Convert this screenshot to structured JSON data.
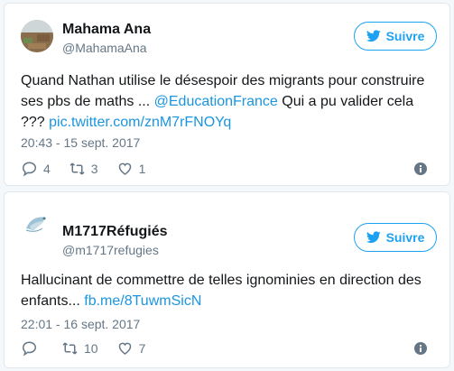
{
  "tweets": [
    {
      "name": "Mahama Ana",
      "handle": "@MahamaAna",
      "follow_label": "Suivre",
      "text_plain": "Quand Nathan utilise le désespoir des migrants pour construire ses pbs de maths ... ",
      "mention": "@EducationFrance",
      "text_after_mention": " Qui a pu valider cela ??? ",
      "link": "pic.twitter.com/znM7rFNOYq",
      "time": "20:43 - 15 sept. 2017",
      "replies": "4",
      "retweets": "3",
      "likes": "1"
    },
    {
      "name": "M1717Réfugiés",
      "handle": "@m1717refugies",
      "follow_label": "Suivre",
      "text_plain": "Hallucinant de commettre de telles ignominies en direction des enfants... ",
      "link": "fb.me/8TuwmSicN",
      "time": "22:01 - 16 sept. 2017",
      "replies": "",
      "retweets": "10",
      "likes": "7"
    }
  ],
  "colors": {
    "accent": "#1da1f2",
    "link": "#1b95e0",
    "muted": "#657786",
    "border": "#e1e8ed"
  },
  "icons": [
    "twitter-bird-icon",
    "reply-icon",
    "retweet-icon",
    "like-icon",
    "info-icon"
  ]
}
